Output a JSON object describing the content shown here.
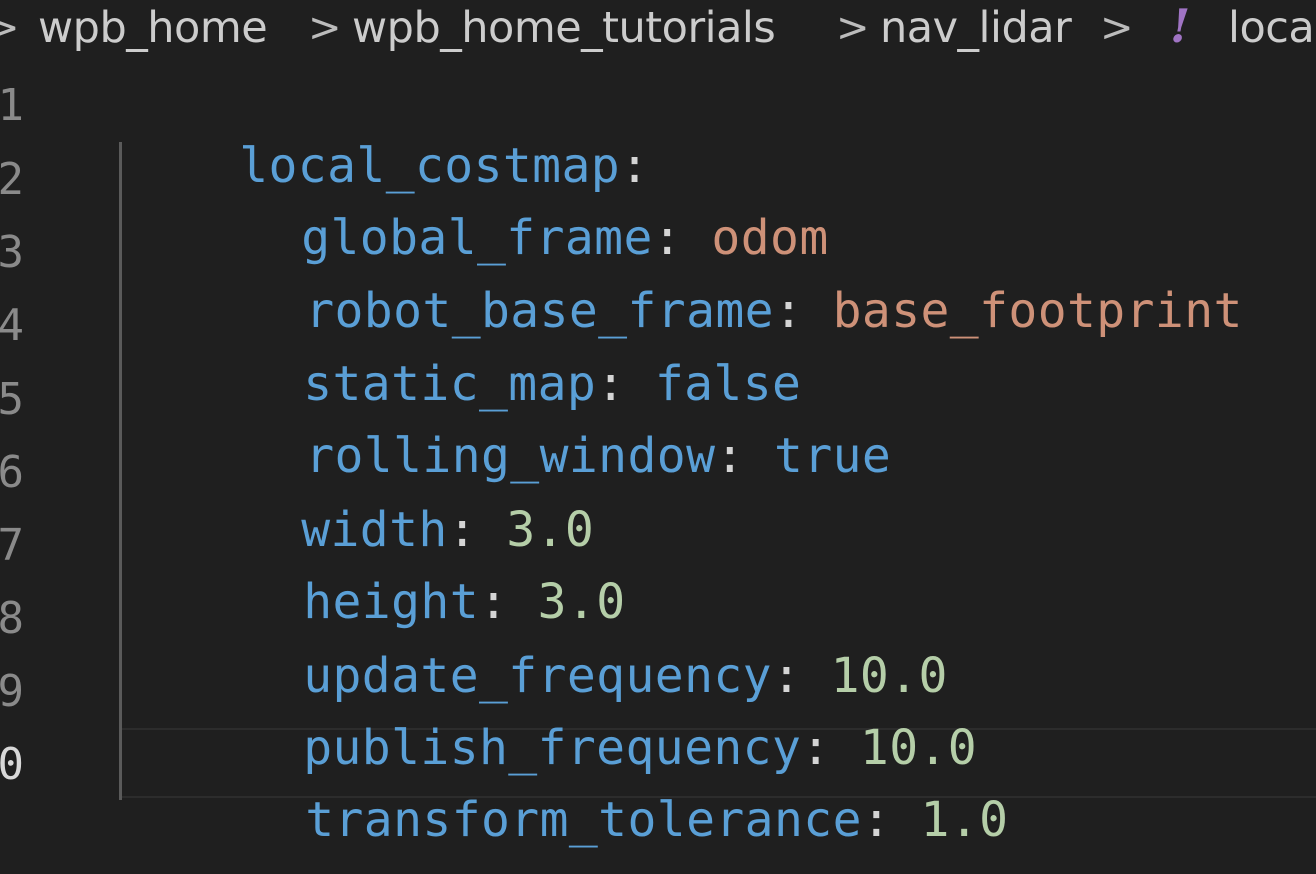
{
  "breadcrumb": {
    "items": [
      "wpb_home",
      "wpb_home_tutorials",
      "nav_lidar",
      "local"
    ],
    "separator": ">",
    "file_icon_glyph": "!"
  },
  "gutter": {
    "line_numbers": [
      "1",
      "2",
      "3",
      "4",
      "5",
      "6",
      "7",
      "8",
      "9",
      "0"
    ],
    "active_line": "0"
  },
  "code": {
    "lines": [
      {
        "key": "local_costmap",
        "colon": ":",
        "value": "",
        "value_type": "none"
      },
      {
        "key": "global_frame",
        "colon": ":",
        "value": "odom",
        "value_type": "string"
      },
      {
        "key": "robot_base_frame",
        "colon": ":",
        "value": "base_footprint",
        "value_type": "string"
      },
      {
        "key": "static_map",
        "colon": ":",
        "value": "false",
        "value_type": "bool"
      },
      {
        "key": "rolling_window",
        "colon": ":",
        "value": "true",
        "value_type": "bool"
      },
      {
        "key": "width",
        "colon": ":",
        "value": "3.0",
        "value_type": "number"
      },
      {
        "key": "height",
        "colon": ":",
        "value": "3.0",
        "value_type": "number"
      },
      {
        "key": "update_frequency",
        "colon": ":",
        "value": "10.0",
        "value_type": "number"
      },
      {
        "key": "publish_frequency",
        "colon": ":",
        "value": "10.0",
        "value_type": "number"
      },
      {
        "key": "transform_tolerance",
        "colon": ":",
        "value": "1.0",
        "value_type": "number"
      }
    ]
  },
  "colors": {
    "background": "#1f1f1f",
    "key": "#5a9fd6",
    "string": "#ce9178",
    "number": "#b5cea8",
    "boolean": "#5a9fd6",
    "yaml_icon": "#a074c4"
  },
  "icons": {
    "separator": "chevron-right-icon",
    "file": "yaml-file-icon"
  }
}
